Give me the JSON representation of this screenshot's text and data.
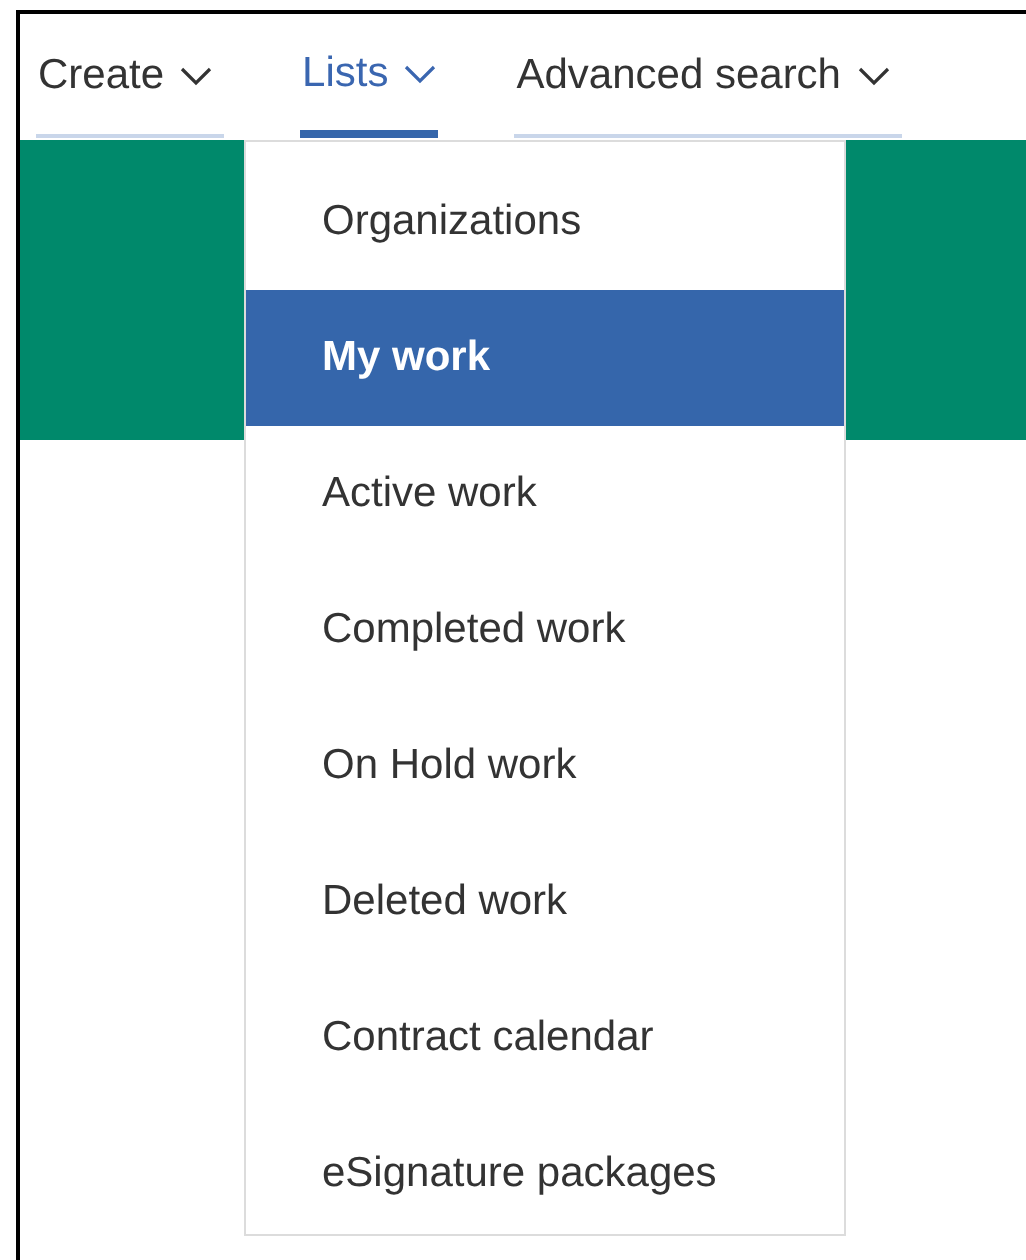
{
  "tabs": [
    {
      "label": "Create",
      "selected": false
    },
    {
      "label": "Lists",
      "selected": true
    },
    {
      "label": "Advanced search",
      "selected": false
    }
  ],
  "menu": {
    "items": [
      {
        "label": "Organizations",
        "selected": false
      },
      {
        "label": "My work",
        "selected": true
      },
      {
        "label": "Active work",
        "selected": false
      },
      {
        "label": "Completed work",
        "selected": false
      },
      {
        "label": "On Hold work",
        "selected": false
      },
      {
        "label": "Deleted work",
        "selected": false
      },
      {
        "label": "Contract calendar",
        "selected": false
      },
      {
        "label": "eSignature packages",
        "selected": false
      }
    ]
  }
}
